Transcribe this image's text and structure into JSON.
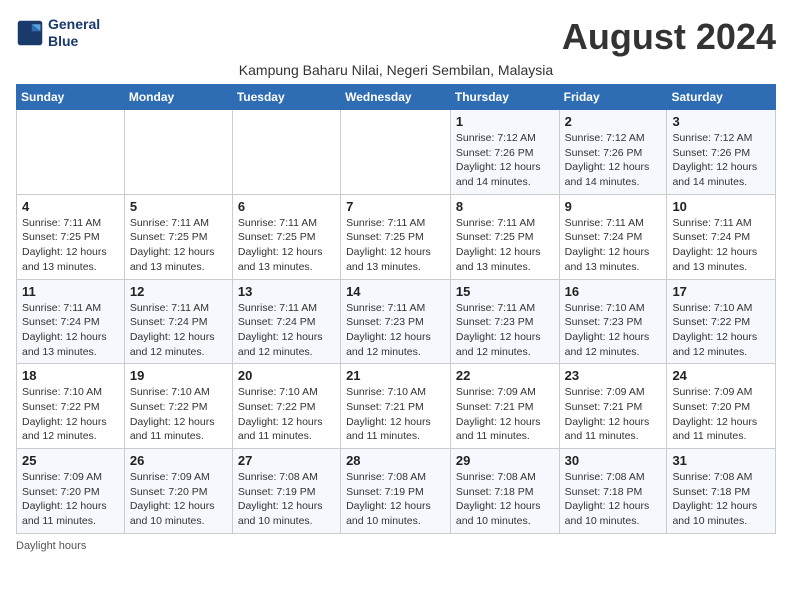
{
  "header": {
    "logo_line1": "General",
    "logo_line2": "Blue",
    "month_year": "August 2024",
    "subtitle": "Kampung Baharu Nilai, Negeri Sembilan, Malaysia"
  },
  "days_of_week": [
    "Sunday",
    "Monday",
    "Tuesday",
    "Wednesday",
    "Thursday",
    "Friday",
    "Saturday"
  ],
  "footer": {
    "note": "Daylight hours"
  },
  "weeks": [
    {
      "days": [
        {
          "num": "",
          "info": ""
        },
        {
          "num": "",
          "info": ""
        },
        {
          "num": "",
          "info": ""
        },
        {
          "num": "",
          "info": ""
        },
        {
          "num": "1",
          "info": "Sunrise: 7:12 AM\nSunset: 7:26 PM\nDaylight: 12 hours\nand 14 minutes."
        },
        {
          "num": "2",
          "info": "Sunrise: 7:12 AM\nSunset: 7:26 PM\nDaylight: 12 hours\nand 14 minutes."
        },
        {
          "num": "3",
          "info": "Sunrise: 7:12 AM\nSunset: 7:26 PM\nDaylight: 12 hours\nand 14 minutes."
        }
      ]
    },
    {
      "days": [
        {
          "num": "4",
          "info": "Sunrise: 7:11 AM\nSunset: 7:25 PM\nDaylight: 12 hours\nand 13 minutes."
        },
        {
          "num": "5",
          "info": "Sunrise: 7:11 AM\nSunset: 7:25 PM\nDaylight: 12 hours\nand 13 minutes."
        },
        {
          "num": "6",
          "info": "Sunrise: 7:11 AM\nSunset: 7:25 PM\nDaylight: 12 hours\nand 13 minutes."
        },
        {
          "num": "7",
          "info": "Sunrise: 7:11 AM\nSunset: 7:25 PM\nDaylight: 12 hours\nand 13 minutes."
        },
        {
          "num": "8",
          "info": "Sunrise: 7:11 AM\nSunset: 7:25 PM\nDaylight: 12 hours\nand 13 minutes."
        },
        {
          "num": "9",
          "info": "Sunrise: 7:11 AM\nSunset: 7:24 PM\nDaylight: 12 hours\nand 13 minutes."
        },
        {
          "num": "10",
          "info": "Sunrise: 7:11 AM\nSunset: 7:24 PM\nDaylight: 12 hours\nand 13 minutes."
        }
      ]
    },
    {
      "days": [
        {
          "num": "11",
          "info": "Sunrise: 7:11 AM\nSunset: 7:24 PM\nDaylight: 12 hours\nand 13 minutes."
        },
        {
          "num": "12",
          "info": "Sunrise: 7:11 AM\nSunset: 7:24 PM\nDaylight: 12 hours\nand 12 minutes."
        },
        {
          "num": "13",
          "info": "Sunrise: 7:11 AM\nSunset: 7:24 PM\nDaylight: 12 hours\nand 12 minutes."
        },
        {
          "num": "14",
          "info": "Sunrise: 7:11 AM\nSunset: 7:23 PM\nDaylight: 12 hours\nand 12 minutes."
        },
        {
          "num": "15",
          "info": "Sunrise: 7:11 AM\nSunset: 7:23 PM\nDaylight: 12 hours\nand 12 minutes."
        },
        {
          "num": "16",
          "info": "Sunrise: 7:10 AM\nSunset: 7:23 PM\nDaylight: 12 hours\nand 12 minutes."
        },
        {
          "num": "17",
          "info": "Sunrise: 7:10 AM\nSunset: 7:22 PM\nDaylight: 12 hours\nand 12 minutes."
        }
      ]
    },
    {
      "days": [
        {
          "num": "18",
          "info": "Sunrise: 7:10 AM\nSunset: 7:22 PM\nDaylight: 12 hours\nand 12 minutes."
        },
        {
          "num": "19",
          "info": "Sunrise: 7:10 AM\nSunset: 7:22 PM\nDaylight: 12 hours\nand 11 minutes."
        },
        {
          "num": "20",
          "info": "Sunrise: 7:10 AM\nSunset: 7:22 PM\nDaylight: 12 hours\nand 11 minutes."
        },
        {
          "num": "21",
          "info": "Sunrise: 7:10 AM\nSunset: 7:21 PM\nDaylight: 12 hours\nand 11 minutes."
        },
        {
          "num": "22",
          "info": "Sunrise: 7:09 AM\nSunset: 7:21 PM\nDaylight: 12 hours\nand 11 minutes."
        },
        {
          "num": "23",
          "info": "Sunrise: 7:09 AM\nSunset: 7:21 PM\nDaylight: 12 hours\nand 11 minutes."
        },
        {
          "num": "24",
          "info": "Sunrise: 7:09 AM\nSunset: 7:20 PM\nDaylight: 12 hours\nand 11 minutes."
        }
      ]
    },
    {
      "days": [
        {
          "num": "25",
          "info": "Sunrise: 7:09 AM\nSunset: 7:20 PM\nDaylight: 12 hours\nand 11 minutes."
        },
        {
          "num": "26",
          "info": "Sunrise: 7:09 AM\nSunset: 7:20 PM\nDaylight: 12 hours\nand 10 minutes."
        },
        {
          "num": "27",
          "info": "Sunrise: 7:08 AM\nSunset: 7:19 PM\nDaylight: 12 hours\nand 10 minutes."
        },
        {
          "num": "28",
          "info": "Sunrise: 7:08 AM\nSunset: 7:19 PM\nDaylight: 12 hours\nand 10 minutes."
        },
        {
          "num": "29",
          "info": "Sunrise: 7:08 AM\nSunset: 7:18 PM\nDaylight: 12 hours\nand 10 minutes."
        },
        {
          "num": "30",
          "info": "Sunrise: 7:08 AM\nSunset: 7:18 PM\nDaylight: 12 hours\nand 10 minutes."
        },
        {
          "num": "31",
          "info": "Sunrise: 7:08 AM\nSunset: 7:18 PM\nDaylight: 12 hours\nand 10 minutes."
        }
      ]
    }
  ]
}
